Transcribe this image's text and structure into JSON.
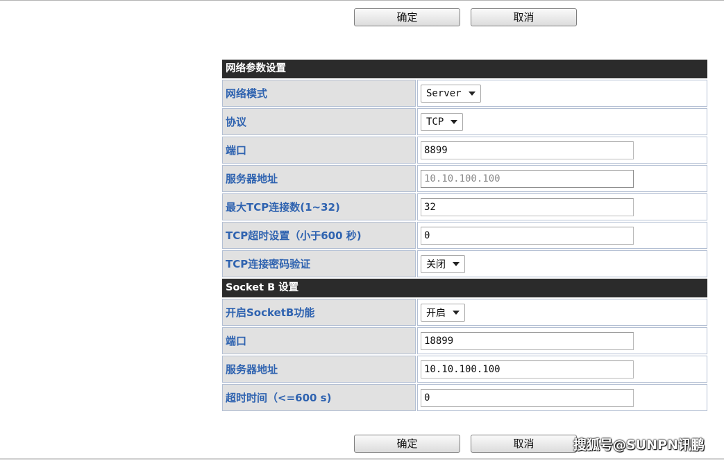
{
  "buttons": {
    "ok": "确定",
    "cancel": "取消"
  },
  "network": {
    "title": "网络参数设置",
    "mode": {
      "label": "网络模式",
      "value": "Server"
    },
    "protocol": {
      "label": "协议",
      "value": "TCP"
    },
    "port": {
      "label": "端口",
      "value": "8899"
    },
    "server_addr": {
      "label": "服务器地址",
      "value": "10.10.100.100"
    },
    "max_tcp": {
      "label": "最大TCP连接数(1~32)",
      "value": "32"
    },
    "tcp_timeout": {
      "label": "TCP超时设置（小于600 秒)",
      "value": "0"
    },
    "tcp_pwd": {
      "label": "TCP连接密码验证",
      "value": "关闭"
    }
  },
  "socketb": {
    "title": "Socket B 设置",
    "enable": {
      "label": "开启SocketB功能",
      "value": "开启"
    },
    "port": {
      "label": "端口",
      "value": "18899"
    },
    "server_addr": {
      "label": "服务器地址",
      "value": "10.10.100.100"
    },
    "timeout": {
      "label": "超时时间（<=600 s)",
      "value": "0"
    }
  },
  "watermark": "搜狐号@SUNPN讯鹏",
  "colors": {
    "section_header_bg": "#2b2b2b",
    "label_bg": "#e1e1e1",
    "label_text": "#2f63b0",
    "cell_border": "#b3bfd3"
  }
}
